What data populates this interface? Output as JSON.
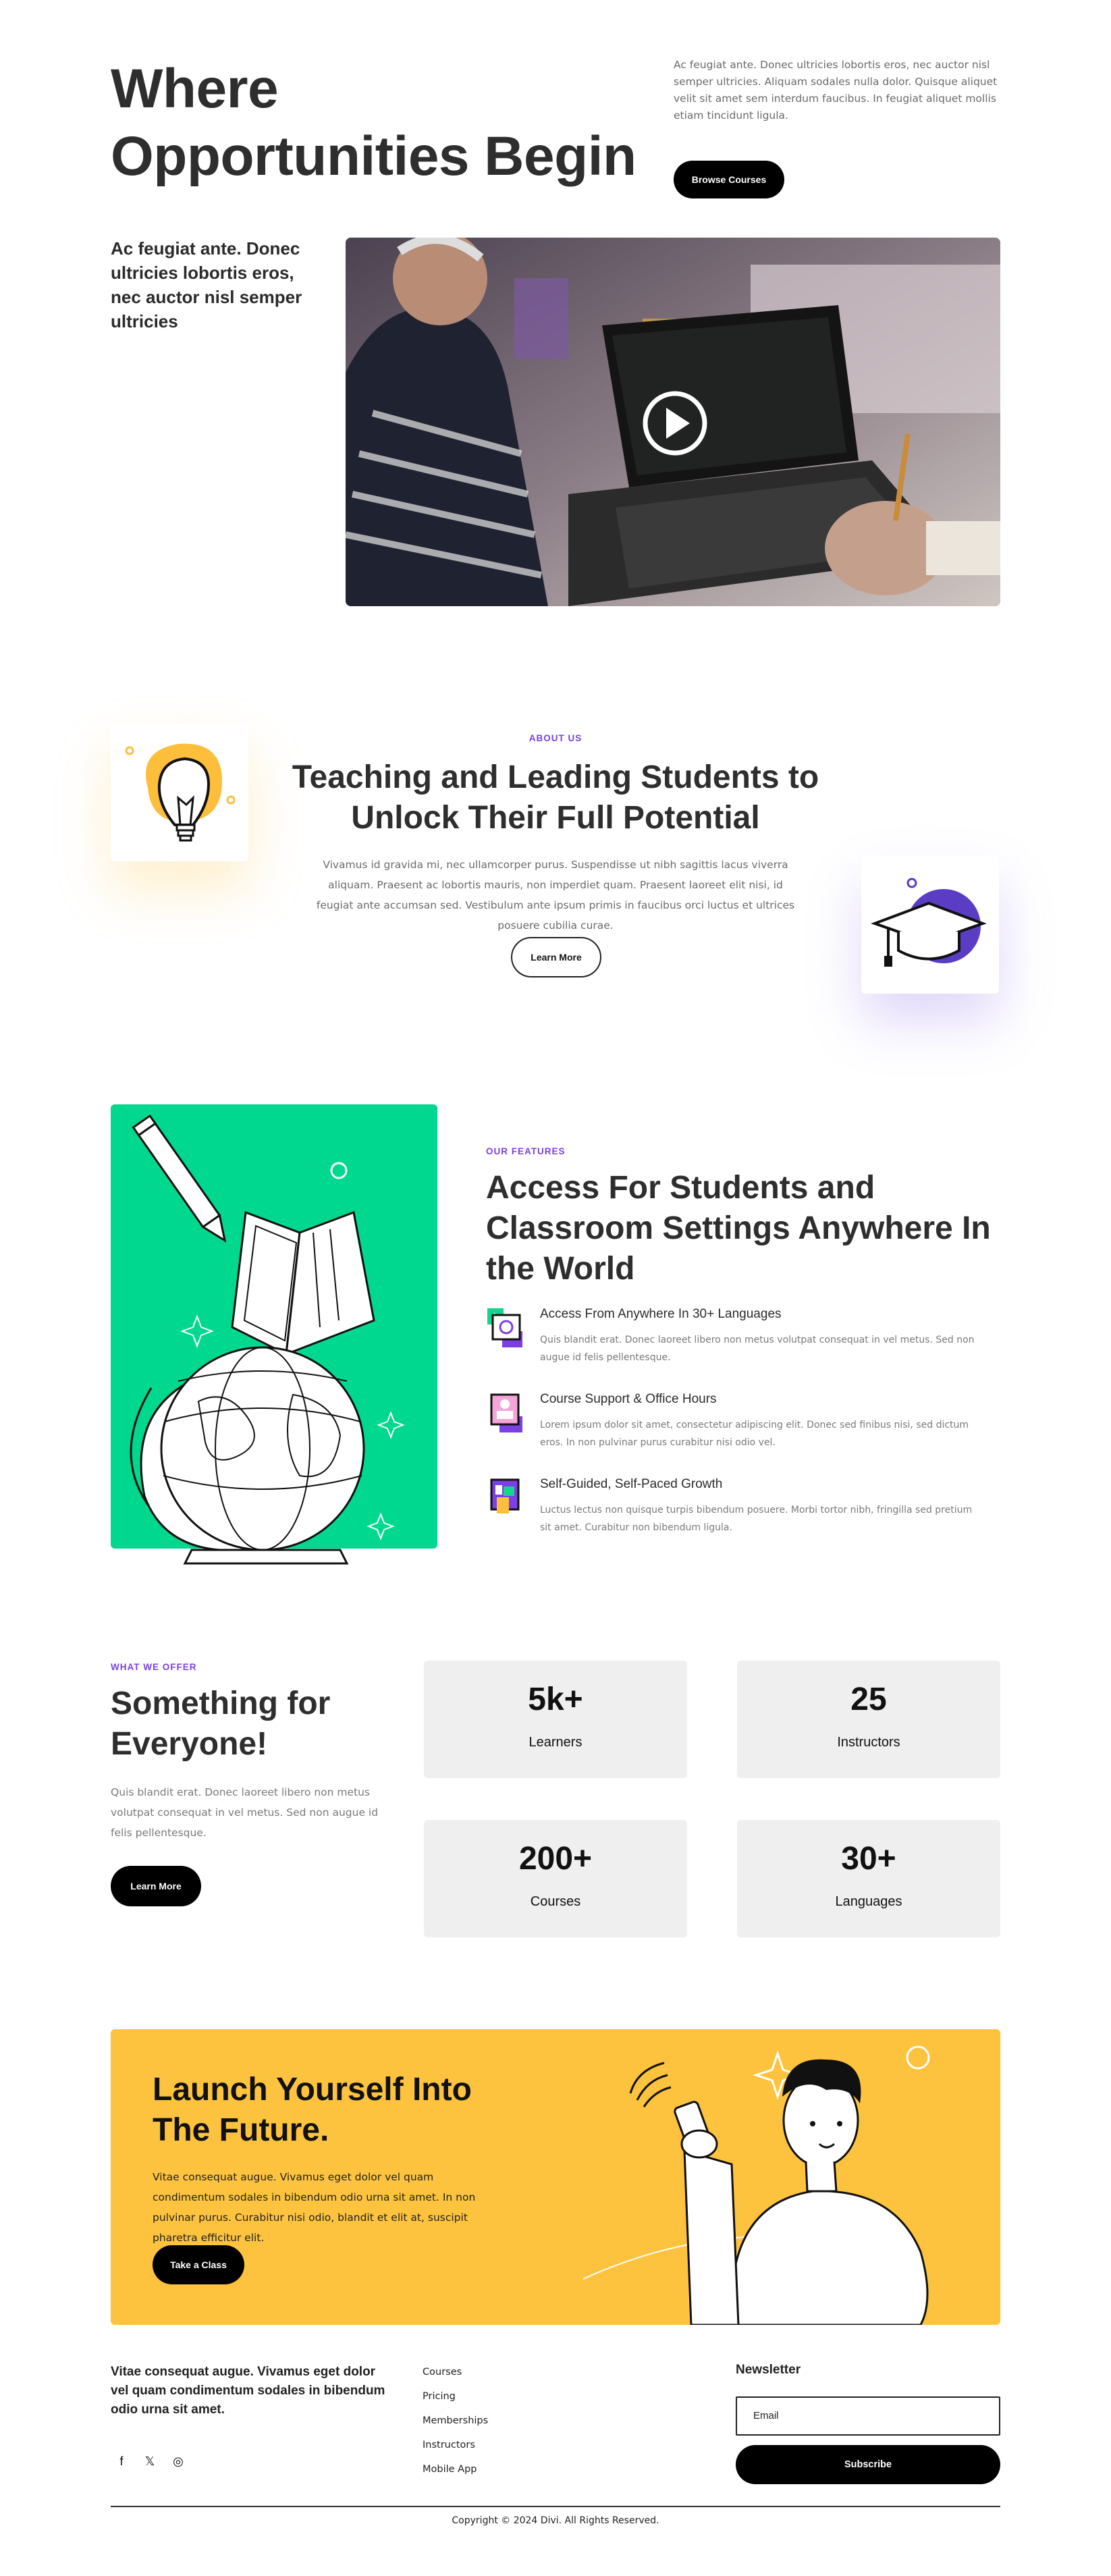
{
  "hero": {
    "title_line1": "Where",
    "title_line2": "Opportunities Begin",
    "description": "Ac feugiat ante. Donec ultricies lobortis eros, nec auctor nisl semper ultricies. Aliquam sodales nulla dolor. Quisque aliquet velit sit amet sem interdum faucibus. In feugiat aliquet mollis etiam tincidunt ligula.",
    "browse_label": "Browse Courses",
    "subheading": "Ac feugiat ante. Donec ultricies lobortis eros, nec auctor nisl semper ultricies"
  },
  "about": {
    "eyebrow": "ABOUT US",
    "title": "Teaching and Leading Students to Unlock Their Full Potential",
    "description": "Vivamus id gravida mi, nec ullamcorper purus. Suspendisse ut nibh sagittis lacus viverra aliquam. Praesent ac lobortis mauris, non imperdiet quam. Praesent laoreet elit nisi, id feugiat ante accumsan sed. Vestibulum ante ipsum primis in faucibus orci luctus et ultrices posuere cubilia curae.",
    "button_label": "Learn More"
  },
  "features": {
    "eyebrow": "OUR FEATURES",
    "title": "Access For Students and Classroom Settings Anywhere In the World",
    "items": [
      {
        "title": "Access From Anywhere In 30+ Languages",
        "description": "Quis blandit erat. Donec laoreet libero non metus volutpat consequat in vel metus. Sed non augue id felis pellentesque."
      },
      {
        "title": "Course Support & Office Hours",
        "description": "Lorem ipsum dolor sit amet, consectetur adipiscing elit. Donec sed finibus nisi, sed dictum eros. In non pulvinar purus curabitur nisi odio vel."
      },
      {
        "title": "Self-Guided, Self-Paced Growth",
        "description": "Luctus lectus non quisque turpis bibendum posuere. Morbi tortor nibh, fringilla sed pretium sit amet. Curabitur non bibendum ligula."
      }
    ]
  },
  "offer": {
    "eyebrow": "WHAT WE OFFER",
    "title": "Something for Everyone!",
    "description": "Quis blandit erat. Donec laoreet libero non metus volutpat consequat in vel metus. Sed non augue id felis pellentesque.",
    "button_label": "Learn More",
    "stats": [
      {
        "value": "5k+",
        "label": "Learners"
      },
      {
        "value": "25",
        "label": "Instructors"
      },
      {
        "value": "200+",
        "label": "Courses"
      },
      {
        "value": "30+",
        "label": "Languages"
      }
    ]
  },
  "cta": {
    "title": "Launch Yourself Into The Future.",
    "description": "Vitae consequat augue. Vivamus eget dolor vel quam condimentum sodales in bibendum odio urna sit amet. In non pulvinar purus. Curabitur nisi odio, blandit et elit at, suscipit pharetra efficitur elit.",
    "button_label": "Take a Class"
  },
  "footer": {
    "text": "Vitae consequat augue. Vivamus eget dolor vel quam condimentum sodales in bibendum odio urna sit amet.",
    "links": [
      "Courses",
      "Pricing",
      "Memberships",
      "Instructors",
      "Mobile App"
    ],
    "newsletter_title": "Newsletter",
    "email_placeholder": "Email",
    "subscribe_label": "Subscribe",
    "social": [
      {
        "name": "facebook-icon",
        "glyph": "f"
      },
      {
        "name": "x-twitter-icon",
        "glyph": "𝕏"
      },
      {
        "name": "instagram-icon",
        "glyph": "◎"
      }
    ],
    "copyright": "Copyright © 2024 Divi. All Rights Reserved."
  },
  "colors": {
    "accent_purple": "#7b3fe4",
    "green_panel": "#00d88f",
    "cta_yellow": "#fec33e",
    "stat_bg": "#efefef",
    "button_dark": "#000000"
  }
}
